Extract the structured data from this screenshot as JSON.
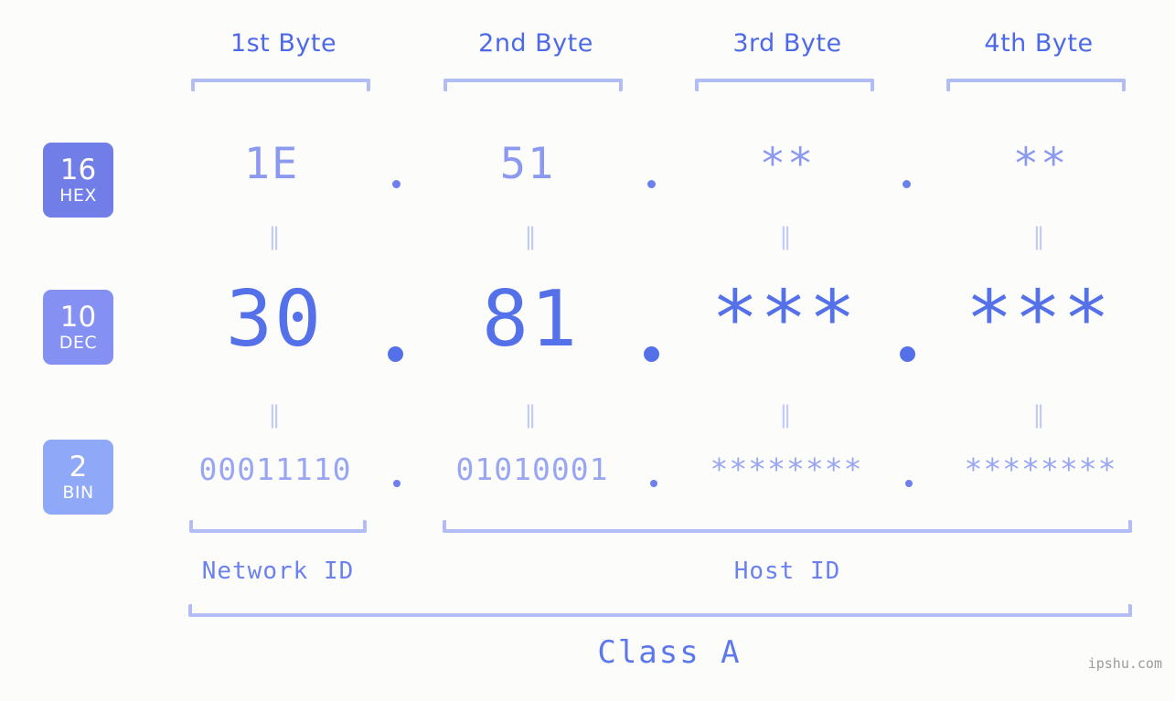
{
  "meta": {
    "background_color": "#fcfdfa",
    "accent_color": "#5571ea",
    "bracket_color": "#b3bdf5",
    "watermark": "ipshu.com"
  },
  "byte_headers": [
    {
      "label": "1st Byte"
    },
    {
      "label": "2nd Byte"
    },
    {
      "label": "3rd Byte"
    },
    {
      "label": "4th Byte"
    }
  ],
  "bases": [
    {
      "number": "16",
      "name": "HEX",
      "color": "#717ee8"
    },
    {
      "number": "10",
      "name": "DEC",
      "color": "#8490f2"
    },
    {
      "number": "2",
      "name": "BIN",
      "color": "#8fa8f7"
    }
  ],
  "rows": {
    "hex": {
      "values": [
        "1E",
        "51",
        "**",
        "**"
      ]
    },
    "dec": {
      "values": [
        "30",
        "81",
        "***",
        "***"
      ]
    },
    "bin": {
      "values": [
        "00011110",
        "01010001",
        "********",
        "********"
      ]
    }
  },
  "separators": {
    "glyph": ".",
    "count": 3
  },
  "equals": {
    "glyph": "‖"
  },
  "segments": [
    {
      "label": "Network ID"
    },
    {
      "label": "Host ID"
    }
  ],
  "class": {
    "label": "Class A"
  }
}
